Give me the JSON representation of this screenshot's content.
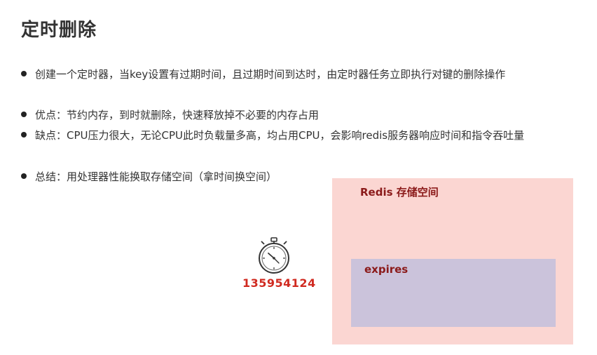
{
  "slide": {
    "title": "定时删除",
    "bullets": [
      "创建一个定时器，当key设置有过期时间，且过期时间到达时，由定时器任务立即执行对键的删除操作",
      "优点：节约内存，到时就删除，快速释放掉不必要的内存占用",
      "缺点：CPU压力很大，无论CPU此时负载量多高，均占用CPU，会影响redis服务器响应时间和指令吞吐量",
      "总结：用处理器性能换取存储空间（拿时间换空间）"
    ]
  },
  "diagram": {
    "redis_label": "Redis 存储空间",
    "expires_label": "expires",
    "timer_value": "135954124",
    "timer_icon": "stopwatch-icon",
    "colors": {
      "redis_box": "#fbd6d2",
      "expires_box": "#cbc3db",
      "label_text": "#8b1a1a",
      "timer_text": "#d02a20"
    }
  }
}
